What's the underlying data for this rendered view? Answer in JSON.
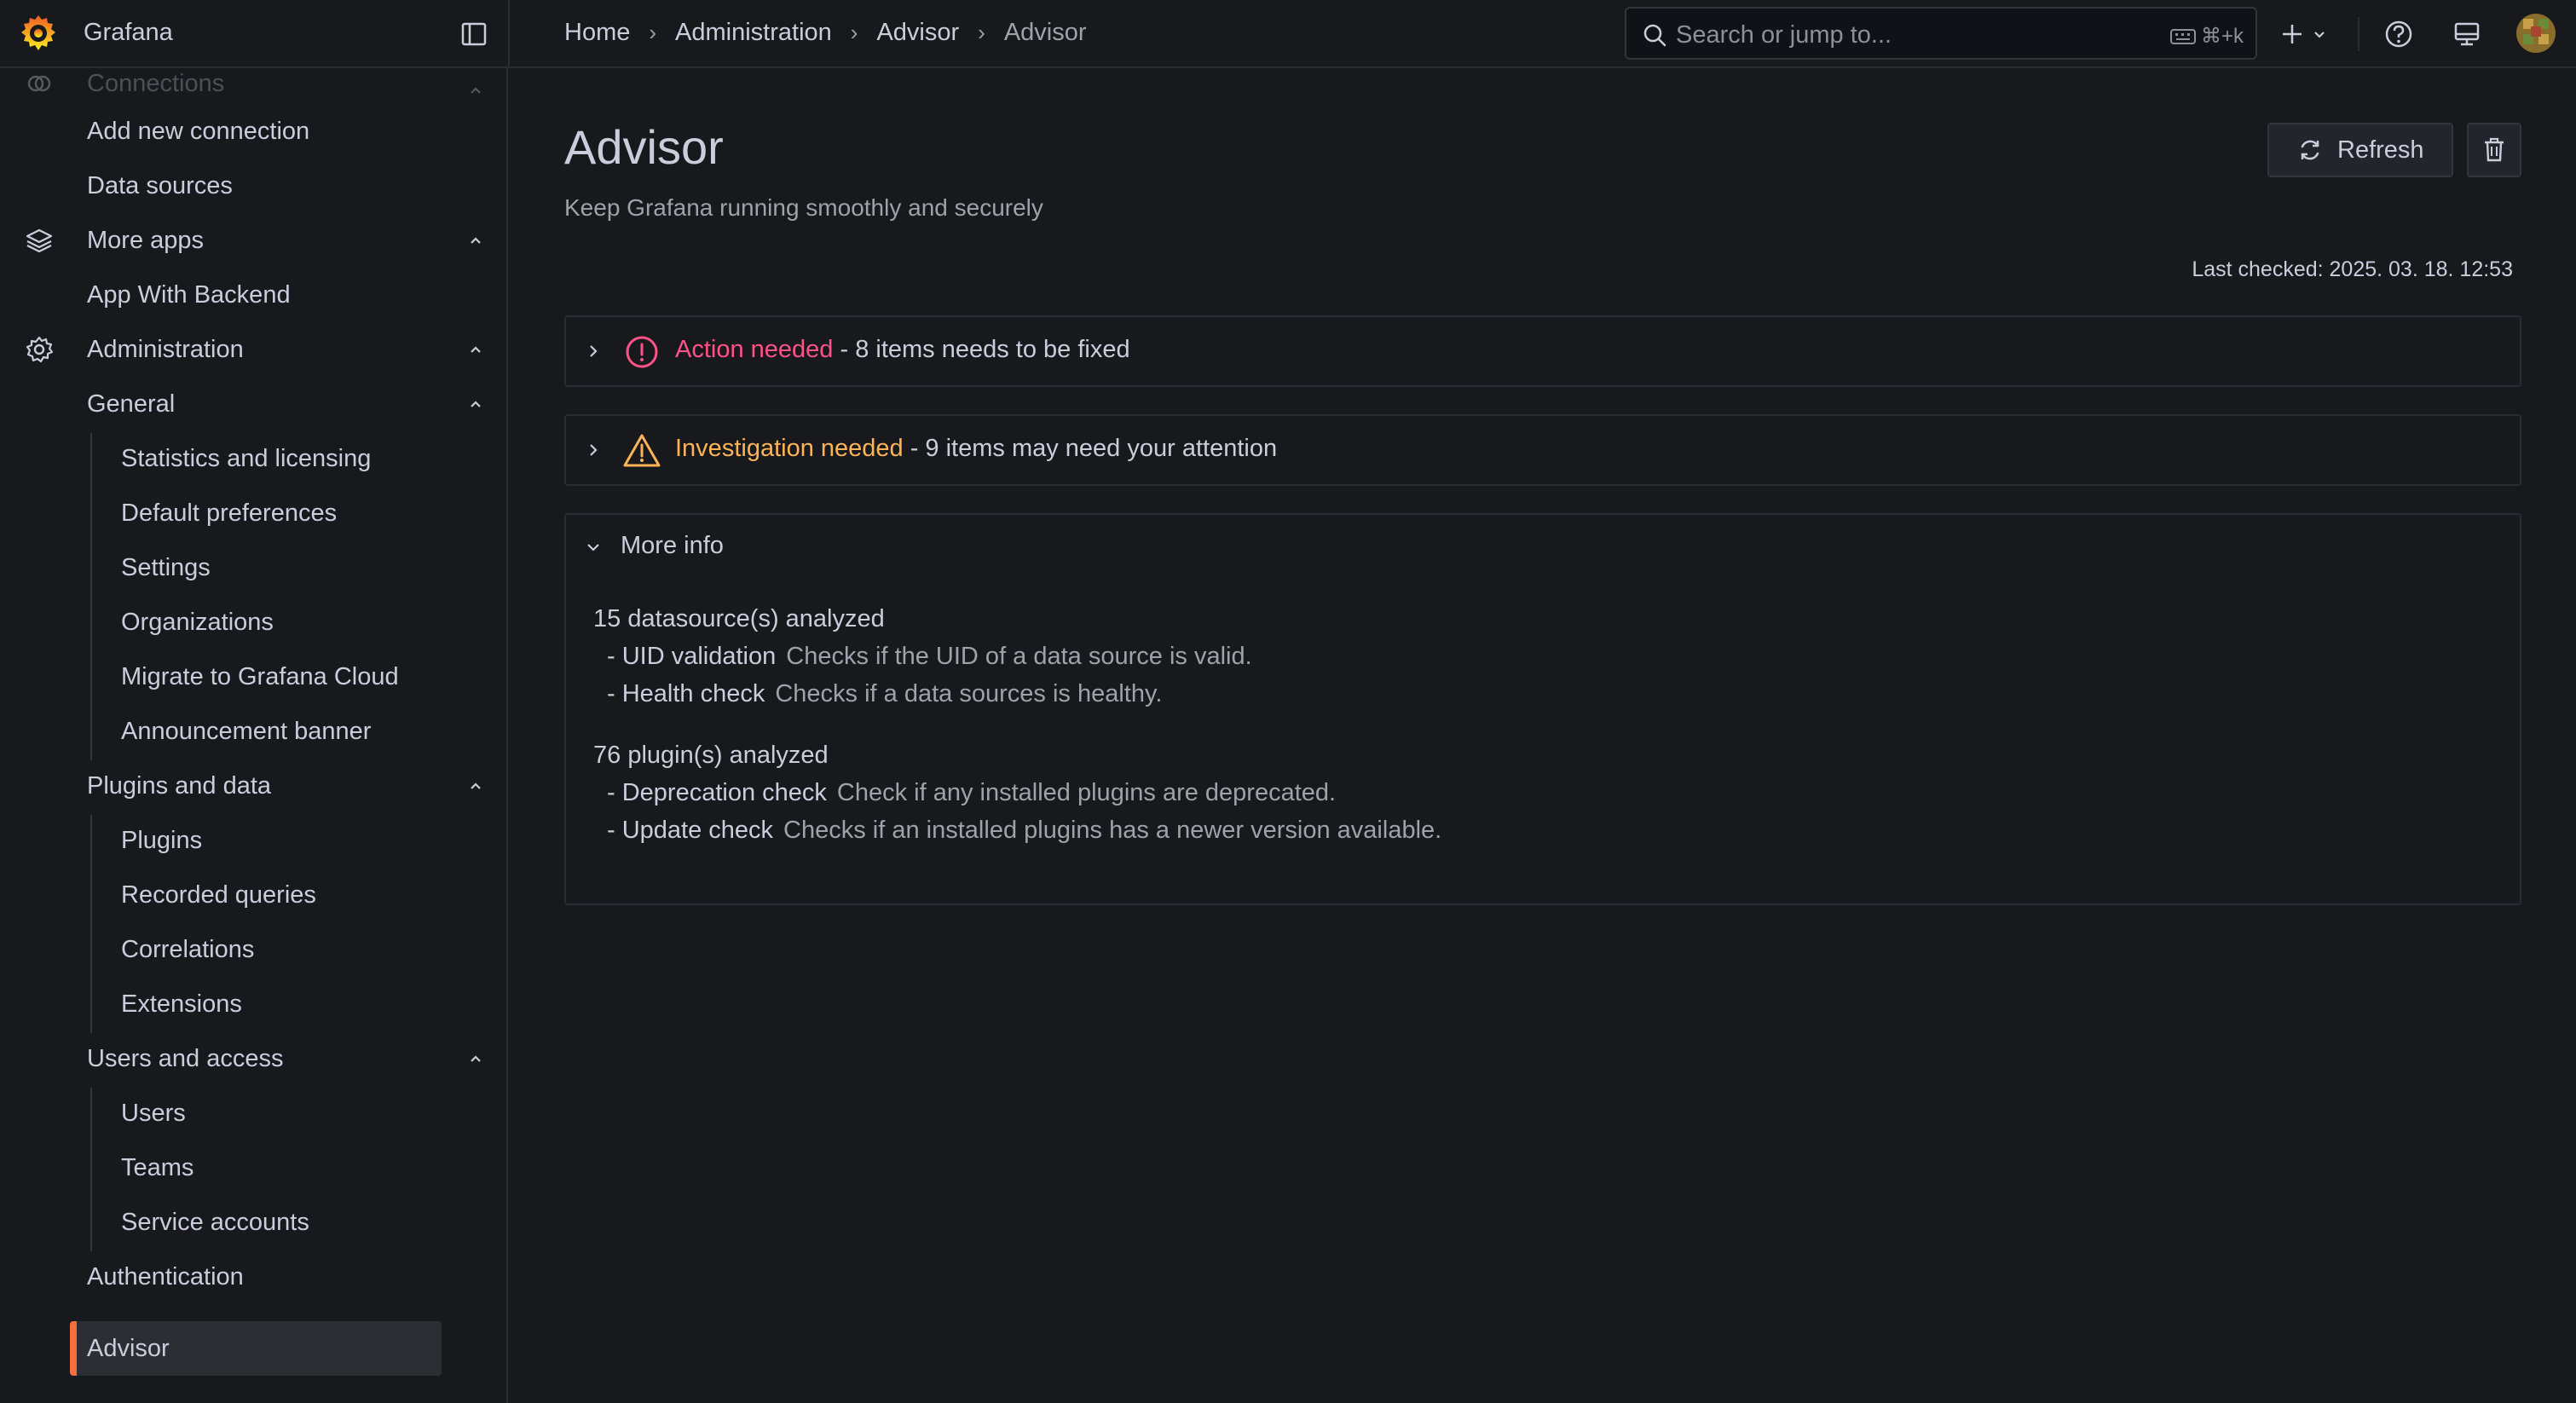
{
  "app": {
    "brand": "Grafana"
  },
  "breadcrumb": [
    "Home",
    "Administration",
    "Advisor",
    "Advisor"
  ],
  "search": {
    "placeholder": "Search or jump to...",
    "shortcut": "⌘+k"
  },
  "sidebar": {
    "items": [
      {
        "label": "Connections",
        "level": 0,
        "icon": "connections-icon",
        "expanded": true,
        "faded": true
      },
      {
        "label": "Add new connection",
        "level": 1
      },
      {
        "label": "Data sources",
        "level": 1
      },
      {
        "label": "More apps",
        "level": 0,
        "icon": "layers-icon",
        "expanded": true
      },
      {
        "label": "App With Backend",
        "level": 1
      },
      {
        "label": "Administration",
        "level": 0,
        "icon": "gear-icon",
        "expanded": true
      },
      {
        "label": "General",
        "level": 1,
        "expanded": true
      },
      {
        "label": "Statistics and licensing",
        "level": 2
      },
      {
        "label": "Default preferences",
        "level": 2
      },
      {
        "label": "Settings",
        "level": 2
      },
      {
        "label": "Organizations",
        "level": 2
      },
      {
        "label": "Migrate to Grafana Cloud",
        "level": 2
      },
      {
        "label": "Announcement banner",
        "level": 2
      },
      {
        "label": "Plugins and data",
        "level": 1,
        "expanded": true
      },
      {
        "label": "Plugins",
        "level": 2
      },
      {
        "label": "Recorded queries",
        "level": 2
      },
      {
        "label": "Correlations",
        "level": 2
      },
      {
        "label": "Extensions",
        "level": 2
      },
      {
        "label": "Users and access",
        "level": 1,
        "expanded": true
      },
      {
        "label": "Users",
        "level": 2
      },
      {
        "label": "Teams",
        "level": 2
      },
      {
        "label": "Service accounts",
        "level": 2
      },
      {
        "label": "Authentication",
        "level": 1
      },
      {
        "label": "Advisor",
        "level": 1,
        "active": true
      }
    ]
  },
  "page": {
    "title": "Advisor",
    "subtitle": "Keep Grafana running smoothly and securely",
    "refresh_label": "Refresh",
    "last_checked": "Last checked: 2025. 03. 18. 12:53"
  },
  "panels": {
    "action": {
      "status": "Action needed",
      "detail": " - 8 items needs to be fixed",
      "color": "#ff5286"
    },
    "investigation": {
      "status": "Investigation needed",
      "detail": " - 9 items may need your attention",
      "color": "#ffb357"
    },
    "more_info": {
      "title": "More info",
      "groups": [
        {
          "heading": "15 datasource(s) analyzed",
          "checks": [
            {
              "name": "- UID validation",
              "desc": "Checks if the UID of a data source is valid."
            },
            {
              "name": "- Health check",
              "desc": "Checks if a data sources is healthy."
            }
          ]
        },
        {
          "heading": "76 plugin(s) analyzed",
          "checks": [
            {
              "name": "- Deprecation check",
              "desc": "Check if any installed plugins are deprecated."
            },
            {
              "name": "- Update check",
              "desc": "Checks if an installed plugins has a newer version available."
            }
          ]
        }
      ]
    }
  },
  "colors": {
    "accent": "#f46e3f",
    "background": "#18191d",
    "error": "#ff5286",
    "warning": "#ffb357"
  }
}
